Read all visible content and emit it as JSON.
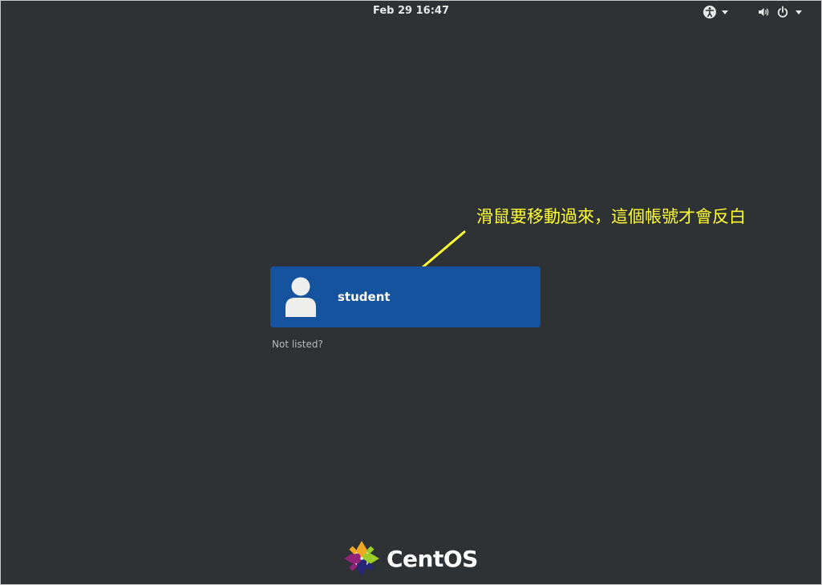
{
  "topbar": {
    "datetime": "Feb 29  16:47",
    "icons": [
      "accessibility-icon",
      "volume-icon",
      "power-icon"
    ]
  },
  "login": {
    "user_name": "student",
    "not_listed": "Not listed?"
  },
  "annotation": {
    "text": "滑鼠要移動過來，這個帳號才會反白",
    "color": "#ffff33"
  },
  "brand": {
    "name": "CentOS"
  },
  "colors": {
    "background": "#2e3235",
    "selected_user": "#15539e"
  }
}
